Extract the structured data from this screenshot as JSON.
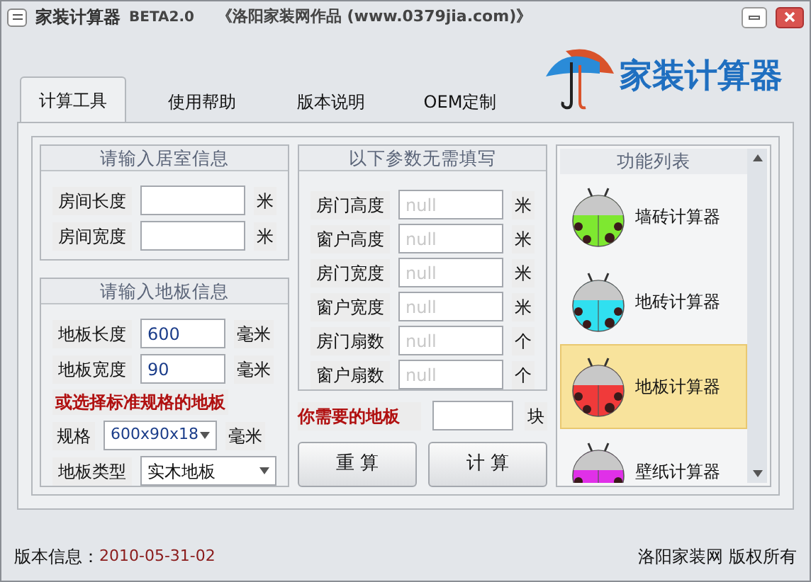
{
  "title_bar": {
    "title": "家装计算器",
    "version": "BETA2.0",
    "subtitle": "《洛阳家装网作品 (www.0379jia.com)》"
  },
  "tabs": [
    {
      "label": "计算工具",
      "selected": true
    },
    {
      "label": "使用帮助",
      "selected": false
    },
    {
      "label": "版本说明",
      "selected": false
    },
    {
      "label": "OEM定制",
      "selected": false
    }
  ],
  "logo": {
    "text": "家装计算器"
  },
  "room_info": {
    "title": "请输入居室信息",
    "fields": [
      {
        "label": "房间长度",
        "unit": "米"
      },
      {
        "label": "房间宽度",
        "unit": "米"
      }
    ]
  },
  "floor_info": {
    "title": "请输入地板信息",
    "fields": [
      {
        "label": "地板长度",
        "value": "600",
        "unit": "毫米"
      },
      {
        "label": "地板宽度",
        "value": "90",
        "unit": "毫米"
      }
    ],
    "note": "或选择标准规格的地板",
    "spec": {
      "label": "规格",
      "value": "600x90x18",
      "unit": "毫米"
    },
    "type": {
      "label": "地板类型",
      "value": "实木地板"
    }
  },
  "optional": {
    "title": "以下参数无需填写",
    "fields": [
      {
        "label": "房门高度",
        "placeholder": "null",
        "unit": "米"
      },
      {
        "label": "窗户高度",
        "placeholder": "null",
        "unit": "米"
      },
      {
        "label": "房门宽度",
        "placeholder": "null",
        "unit": "米"
      },
      {
        "label": "窗户宽度",
        "placeholder": "null",
        "unit": "米"
      },
      {
        "label": "房门扇数",
        "placeholder": "null",
        "unit": "个"
      },
      {
        "label": "窗户扇数",
        "placeholder": "null",
        "unit": "个"
      }
    ]
  },
  "result": {
    "label": "你需要的地板",
    "unit": "块"
  },
  "buttons": [
    "重 算",
    "计 算"
  ],
  "function_list": {
    "title": "功能列表",
    "items": [
      {
        "label": "墙砖计算器",
        "color": "#7ee830",
        "selected": false
      },
      {
        "label": "地砖计算器",
        "color": "#30e0f0",
        "selected": false
      },
      {
        "label": "地板计算器",
        "color": "#f03a3a",
        "selected": true
      },
      {
        "label": "壁纸计算器",
        "color": "#e030e8",
        "selected": false
      }
    ]
  },
  "footer": {
    "label": "版本信息：",
    "date": "2010-05-31-02",
    "copyright": "洛阳家装网 版权所有"
  }
}
